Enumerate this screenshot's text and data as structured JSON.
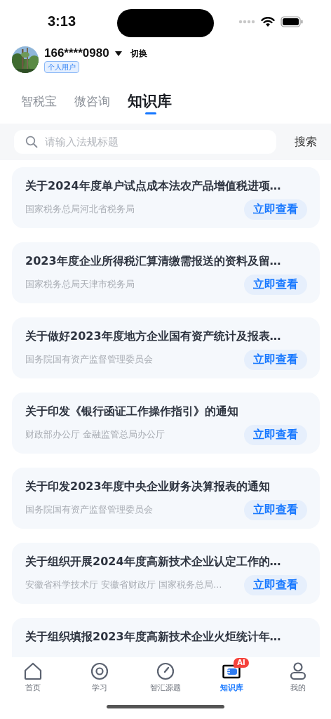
{
  "status_bar": {
    "time": "3:13"
  },
  "user": {
    "phone": "166****0980",
    "switch": "切换",
    "badge": "个人用户"
  },
  "tabs": [
    {
      "label": "智税宝",
      "selected": false
    },
    {
      "label": "微咨询",
      "selected": false
    },
    {
      "label": "知识库",
      "selected": true
    }
  ],
  "search": {
    "placeholder": "请输入法规标题",
    "button": "搜索"
  },
  "articles": [
    {
      "title": "关于2024年度单户试点成本法农产品增值税进项…",
      "source": "国家税务总局河北省税务局",
      "action": "立即查看"
    },
    {
      "title": "2023年度企业所得税汇算清缴需报送的资料及留…",
      "source": "国家税务总局天津市税务局",
      "action": "立即查看"
    },
    {
      "title": "关于做好2023年度地方企业国有资产统计及报表…",
      "source": "国务院国有资产监督管理委员会",
      "action": "立即查看"
    },
    {
      "title": "关于印发《银行函证工作操作指引》的通知",
      "source": "财政部办公厅 金融监管总局办公厅",
      "action": "立即查看"
    },
    {
      "title": "关于印发2023年度中央企业财务决算报表的通知",
      "source": "国务院国有资产监督管理委员会",
      "action": "立即查看"
    },
    {
      "title": "关于组织开展2024年度高新技术企业认定工作的…",
      "source": "安徽省科学技术厅 安徽省财政厅 国家税务总局…",
      "action": "立即查看"
    },
    {
      "title": "关于组织填报2023年度高新技术企业火炬统计年…"
    }
  ],
  "tab_bar": [
    {
      "kind": "home",
      "label": "首页",
      "selected": false
    },
    {
      "kind": "study",
      "label": "学习",
      "selected": false
    },
    {
      "kind": "gauge",
      "label": "智汇源题",
      "selected": false
    },
    {
      "kind": "library",
      "label": "知识库",
      "selected": true,
      "badge": "AI"
    },
    {
      "kind": "user",
      "label": "我的",
      "selected": false
    }
  ]
}
